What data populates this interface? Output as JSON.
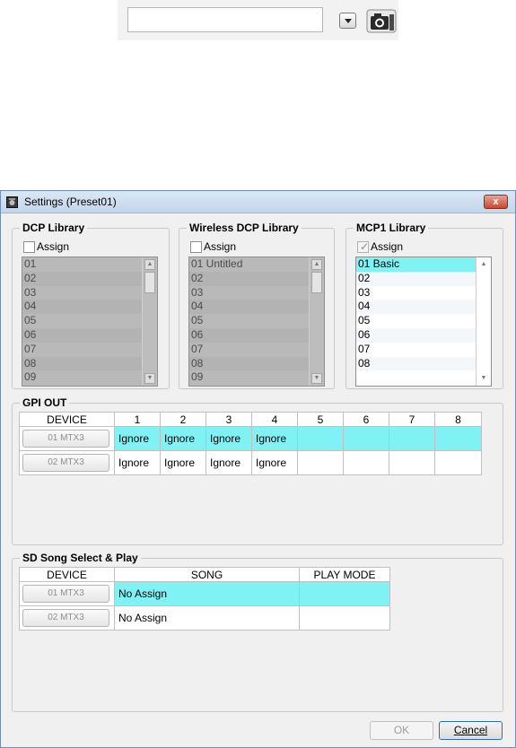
{
  "toolbar": {
    "dropdown_icon": "dropdown-arrow-icon",
    "camera_icon": "camera-icon"
  },
  "window": {
    "title": "Settings (Preset01)",
    "close_label": "x"
  },
  "dcp_library": {
    "title": "DCP Library",
    "assign_label": "Assign",
    "assigned": false,
    "items": [
      "01",
      "02",
      "03",
      "04",
      "05",
      "06",
      "07",
      "08",
      "09"
    ]
  },
  "wireless_dcp_library": {
    "title": "Wireless DCP Library",
    "assign_label": "Assign",
    "assigned": false,
    "items": [
      "01 Untitled",
      "02",
      "03",
      "04",
      "05",
      "06",
      "07",
      "08",
      "09"
    ]
  },
  "mcp1_library": {
    "title": "MCP1 Library",
    "assign_label": "Assign",
    "assigned": true,
    "selected_index": 0,
    "items": [
      "01 Basic",
      "02",
      "03",
      "04",
      "05",
      "06",
      "07",
      "08"
    ]
  },
  "gpi_out": {
    "title": "GPI OUT",
    "headers": [
      "DEVICE",
      "1",
      "2",
      "3",
      "4",
      "5",
      "6",
      "7",
      "8"
    ],
    "rows": [
      {
        "device": "01 MTX3",
        "values": [
          "Ignore",
          "Ignore",
          "Ignore",
          "Ignore",
          "",
          "",
          "",
          ""
        ]
      },
      {
        "device": "02 MTX3",
        "values": [
          "Ignore",
          "Ignore",
          "Ignore",
          "Ignore",
          "",
          "",
          "",
          ""
        ]
      }
    ]
  },
  "sd_song": {
    "title": "SD Song Select & Play",
    "headers": [
      "DEVICE",
      "SONG",
      "PLAY MODE"
    ],
    "rows": [
      {
        "device": "01 MTX3",
        "song": "No Assign",
        "play_mode": ""
      },
      {
        "device": "02 MTX3",
        "song": "No Assign",
        "play_mode": ""
      }
    ]
  },
  "buttons": {
    "ok": "OK",
    "cancel": "Cancel"
  },
  "colors": {
    "highlight": "#80f2f4",
    "disabled_list": "#b9b9b9"
  }
}
